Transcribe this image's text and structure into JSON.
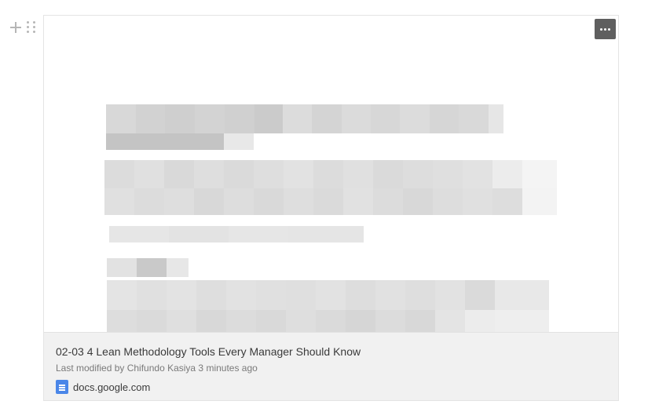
{
  "block": {
    "add_icon": "plus-icon",
    "drag_icon": "drag-handle-icon"
  },
  "card": {
    "more_icon": "more-horizontal-icon",
    "title": "02-03 4 Lean Methodology Tools Every Manager Should Know",
    "meta": "Last modified by Chifundo Kasiya 3 minutes ago",
    "source_icon": "google-docs-icon",
    "source": "docs.google.com"
  },
  "colors": {
    "footer_bg": "#f1f1f1",
    "menu_button": "#5f5f5f",
    "gdoc_blue": "#4a86e8"
  }
}
